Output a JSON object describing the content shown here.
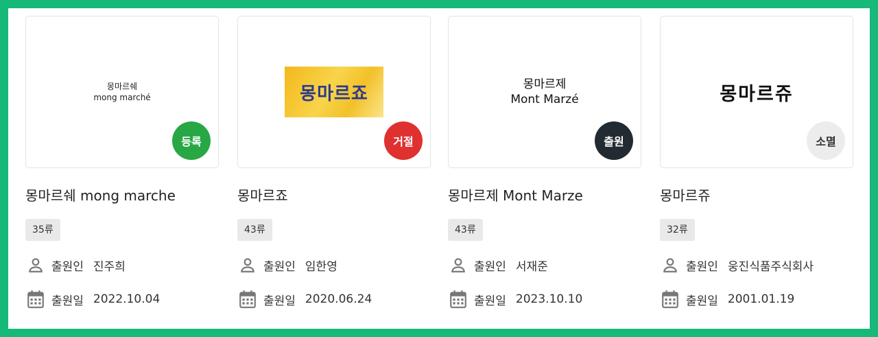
{
  "labels": {
    "applicant": "출원인",
    "date": "출원일"
  },
  "cards": [
    {
      "logo_lines": [
        "몽마르쉐",
        "mong marché"
      ],
      "status": "등록",
      "title": "몽마르쉐 mong marche",
      "class": "35류",
      "applicant": "진주희",
      "date": "2022.10.04"
    },
    {
      "logo_lines": [
        "몽마르죠"
      ],
      "status": "거절",
      "title": "몽마르죠",
      "class": "43류",
      "applicant": "임한영",
      "date": "2020.06.24"
    },
    {
      "logo_lines": [
        "몽마르제",
        "Mont Marzé"
      ],
      "status": "출원",
      "title": "몽마르제 Mont Marze",
      "class": "43류",
      "applicant": "서재준",
      "date": "2023.10.10"
    },
    {
      "logo_lines": [
        "몽마르쥬"
      ],
      "status": "소멸",
      "title": "몽마르쥬",
      "class": "32류",
      "applicant": "웅진식품주식회사",
      "date": "2001.01.19"
    }
  ],
  "colors": {
    "frame": "#16b97a",
    "status_registered": "#28a745",
    "status_rejected": "#e03131",
    "status_applied": "#212b31",
    "status_expired": "#ececec"
  },
  "icons": {
    "applicant": "person-icon",
    "date": "calendar-icon"
  }
}
